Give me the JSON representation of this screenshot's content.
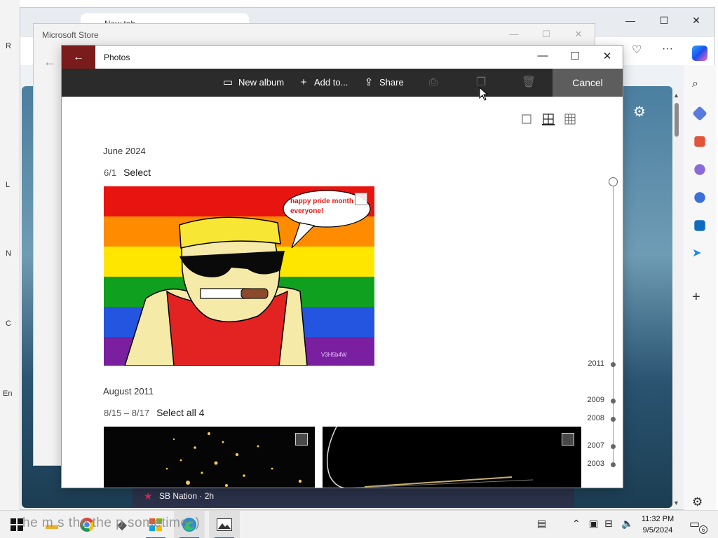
{
  "desktop": {
    "left_marks": [
      "R",
      "L",
      "N",
      "C",
      "En"
    ]
  },
  "edge": {
    "tab_label": "New tab",
    "controls": {
      "minimize": "—",
      "maximize": "☐",
      "close": "✕"
    },
    "toolbar_more": "···",
    "newsfeed_item": "SB Nation · 2h",
    "sidebar_icons": [
      "copilot-icon",
      "search-icon",
      "tag-icon",
      "toolbox-icon",
      "people-icon",
      "office-icon",
      "outlook-icon",
      "send-icon",
      "add-icon",
      "settings-icon"
    ]
  },
  "store": {
    "title": "Microsoft Store",
    "controls": {
      "minimize": "—",
      "maximize": "☐",
      "close": "✕"
    },
    "back": "←"
  },
  "photos": {
    "title": "Photos",
    "back": "←",
    "controls": {
      "minimize": "—",
      "maximize": "☐",
      "close": "✕"
    },
    "commands": {
      "new_album": "New album",
      "add_to": "Add to...",
      "share": "Share",
      "cancel": "Cancel"
    },
    "sections": [
      {
        "month": "June 2024",
        "range": "6/1",
        "select": "Select"
      },
      {
        "month": "August 2011",
        "range": "8/15 – 8/17",
        "select": "Select all 4"
      }
    ],
    "photo1": {
      "speech": "happy pride month everyone!",
      "signature": "V3H5b4W"
    },
    "timeline": {
      "years": [
        "2011",
        "2009",
        "2008",
        "2007",
        "2003"
      ]
    }
  },
  "taskbar": {
    "overlay_caption": "he m s the the p sometimes)",
    "clock_time": "11:32 PM",
    "clock_date": "9/5/2024",
    "notification_count": "6"
  },
  "colors": {
    "photos_back_bg": "#7a1c1c",
    "cmdbar_bg": "#2b2b2b",
    "cancel_bg": "#5d5d5d",
    "taskbar_bg": "#f1f1f1",
    "accent": "#0078d4"
  }
}
